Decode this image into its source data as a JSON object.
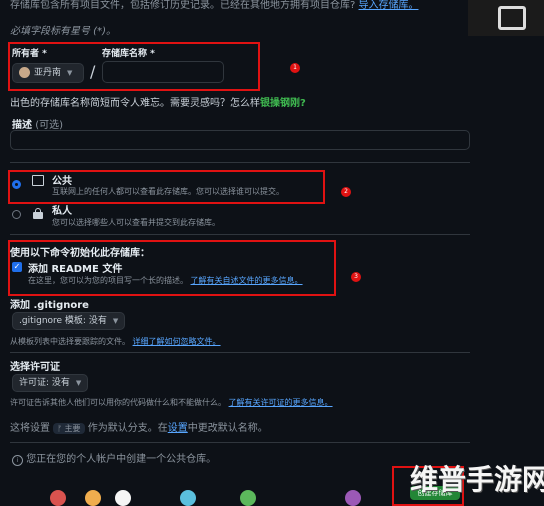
{
  "intro": {
    "line1": "存储库包含所有项目文件，包括修订历史记录。已经在其他地方拥有项目仓库?",
    "import_link": "导入存储库。",
    "required_note": "必填字段标有星号 (*)。"
  },
  "owner": {
    "label": "所有者 *",
    "value": "亚丹南",
    "slash": "/"
  },
  "repo_name": {
    "label": "存储库名称 *",
    "value": ""
  },
  "name_hint": {
    "text": "出色的存储库名称简短而令人难忘。需要灵感吗？怎么样",
    "suggestion": "银操钢刚?"
  },
  "description": {
    "label": "描述",
    "optional": "(可选)",
    "value": ""
  },
  "visibility": {
    "public_title": "公共",
    "public_desc": "互联网上的任何人都可以查看此存储库。您可以选择谁可以提交。",
    "private_title": "私人",
    "private_desc": "您可以选择哪些人可以查看并提交到此存储库。"
  },
  "init": {
    "title": "使用以下命令初始化此存储库：",
    "readme_label": "添加 README 文件",
    "readme_desc": "在这里，您可以为您的项目写一个长的描述。",
    "readme_link": "了解有关自述文件的更多信息。"
  },
  "gitignore": {
    "title": "添加 .gitignore",
    "select_label": ".gitignore 模板: 没有",
    "hint": "从模板列表中选择要跟踪的文件。",
    "hint_link": "详细了解如何忽略文件。"
  },
  "license": {
    "title": "选择许可证",
    "select_label": "许可证: 没有",
    "hint": "许可证告诉其他人他们可以用你的代码做什么和不能做什么。",
    "hint_link": "了解有关许可证的更多信息。"
  },
  "branch": {
    "prefix": "这将设置",
    "branch_name": "主要",
    "middle": "作为默认分支。在",
    "settings_link": "设置",
    "suffix": "中更改默认名称。"
  },
  "notice": "您正在您的个人帐户中创建一个公共仓库。",
  "create_button": "创建存储库",
  "markers": [
    "1",
    "2",
    "3"
  ],
  "watermark": "维普手游网",
  "colors": {
    "background": "#0d1117",
    "annotation_red": "#e01212",
    "link": "#58a6ff",
    "accent_blue": "#1f6feb"
  },
  "dock": [
    "red-app-icon",
    "orange-app-icon",
    "white-app-icon",
    "blue-app-icon",
    "teal-app-icon",
    "purple-app-icon"
  ]
}
